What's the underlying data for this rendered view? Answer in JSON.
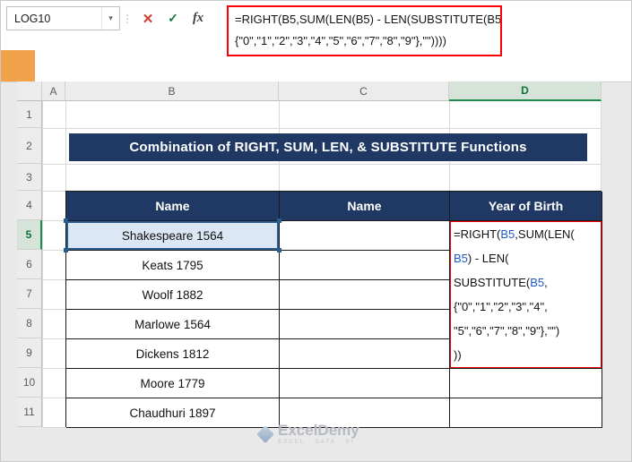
{
  "colors": {
    "banner_navy": "#1f3864",
    "annotation_red": "#fb0007",
    "selected_header_green": "#1f8a50",
    "selection_blue": "#2b5c8f",
    "reference_blue": "#2057c7"
  },
  "icons": {
    "chevron_down": "▾",
    "handle_dots": "⋮",
    "cancel": "✕",
    "enter": "✓",
    "fx": "fx"
  },
  "formula_bar": {
    "name_box_value": "LOG10",
    "formula_lines": [
      "=RIGHT(B5,SUM(LEN(B5) - LEN(SUBSTITUTE(B5,",
      "{\"0\",\"1\",\"2\",\"3\",\"4\",\"5\",\"6\",\"7\",\"8\",\"9\"},\"\"))))"
    ]
  },
  "sheet": {
    "column_headers": [
      "A",
      "B",
      "C",
      "D"
    ],
    "row_headers": [
      "1",
      "2",
      "3",
      "4",
      "5",
      "6",
      "7",
      "8",
      "9",
      "10",
      "11"
    ],
    "selected_column": "D",
    "selected_row": "5",
    "title_banner": "Combination of RIGHT, SUM, LEN, & SUBSTITUTE Functions",
    "table": {
      "header_b": "Name",
      "header_c": "Name",
      "header_d": "Year of Birth",
      "names": [
        "Shakespeare 1564",
        "Keats 1795",
        "Woolf 1882",
        "Marlowe 1564",
        "Dickens 1812",
        "Moore 1779",
        "Chaudhuri 1897"
      ]
    },
    "d5_formula_lines": [
      [
        {
          "t": "=RIGHT(",
          "c": "k"
        },
        {
          "t": "B5",
          "c": "b"
        },
        {
          "t": ",SUM(LEN(",
          "c": "k"
        }
      ],
      [
        {
          "t": "B5",
          "c": "b"
        },
        {
          "t": ") - LEN(",
          "c": "k"
        }
      ],
      [
        {
          "t": "SUBSTITUTE(",
          "c": "k"
        },
        {
          "t": "B5",
          "c": "b"
        },
        {
          "t": ",",
          "c": "k"
        }
      ],
      [
        {
          "t": "{\"0\",\"1\",\"2\",\"3\",\"4\",",
          "c": "k"
        }
      ],
      [
        {
          "t": "\"5\",\"6\",\"7\",\"8\",\"9\"},\"\")",
          "c": "k"
        }
      ],
      [
        {
          "t": "))",
          "c": "k"
        }
      ]
    ]
  },
  "watermark": {
    "brand": "ExcelDemy",
    "tagline": "EXCEL · DATA · BI"
  }
}
